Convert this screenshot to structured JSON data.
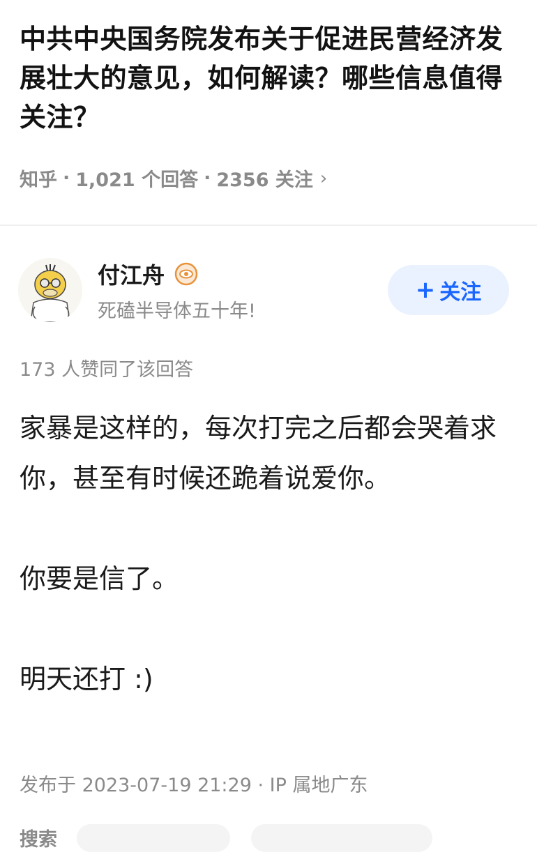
{
  "question": {
    "title": "中共中央国务院发布关于促进民营经济发展壮大的意见，如何解读？哪些信息值得关注？",
    "source": "知乎",
    "answers_count": "1,021 个回答",
    "followers_count": "2356 关注",
    "chevron": "›"
  },
  "author": {
    "name": "付江舟",
    "bio": "死磕半导体五十年!",
    "badge_icon": "eye-badge-icon",
    "follow_label": "关注",
    "follow_plus": "+"
  },
  "answer": {
    "votes": "173 人赞同了该回答",
    "paragraphs": [
      "家暴是这样的，每次打完之后都会哭着求你，甚至有时候还跪着说爱你。",
      "你要是信了。",
      "明天还打 :)"
    ],
    "published": "发布于 2023-07-19 21:29 · IP 属地广东"
  },
  "footer": {
    "label": "搜索"
  },
  "colors": {
    "accent": "#1a66ff",
    "follow_bg": "#eaf2ff",
    "muted": "#8a8a8a",
    "badge": "#e8923a"
  }
}
